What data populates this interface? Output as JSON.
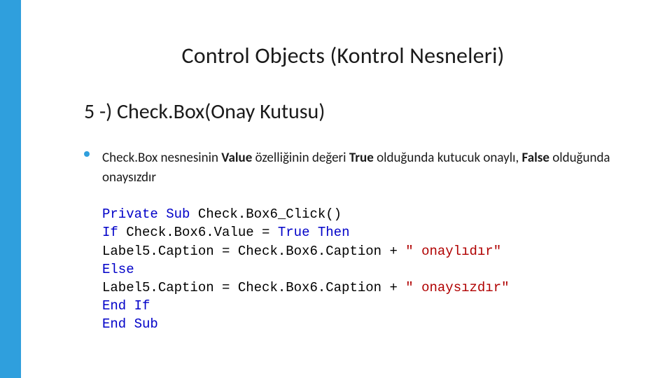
{
  "title": "Control Objects (Kontrol Nesneleri)",
  "subtitle": "5 -) Check.Box(Onay Kutusu)",
  "bullet": {
    "p1": "Check.Box nesnesinin ",
    "b1": "Value",
    "p2": " özelliğinin değeri ",
    "b2": "True",
    "p3": " olduğunda kutucuk onaylı, ",
    "b3": "False",
    "p4": " olduğunda onaysızdır"
  },
  "code": {
    "l1a": "Private Sub",
    "l1b": " Check.Box6_Click()",
    "l2a": "If",
    "l2b": " Check.Box6.Value = ",
    "l2c": "True",
    "l2d": " Then",
    "l3a": "Label5.Caption = Check.Box6.Caption + ",
    "l3b": "\" onaylıdır\"",
    "l4": "Else",
    "l5a": "Label5.Caption = Check.Box6.Caption + ",
    "l5b": "\" onaysızdır\"",
    "l6": "End If",
    "l7": "End Sub"
  }
}
